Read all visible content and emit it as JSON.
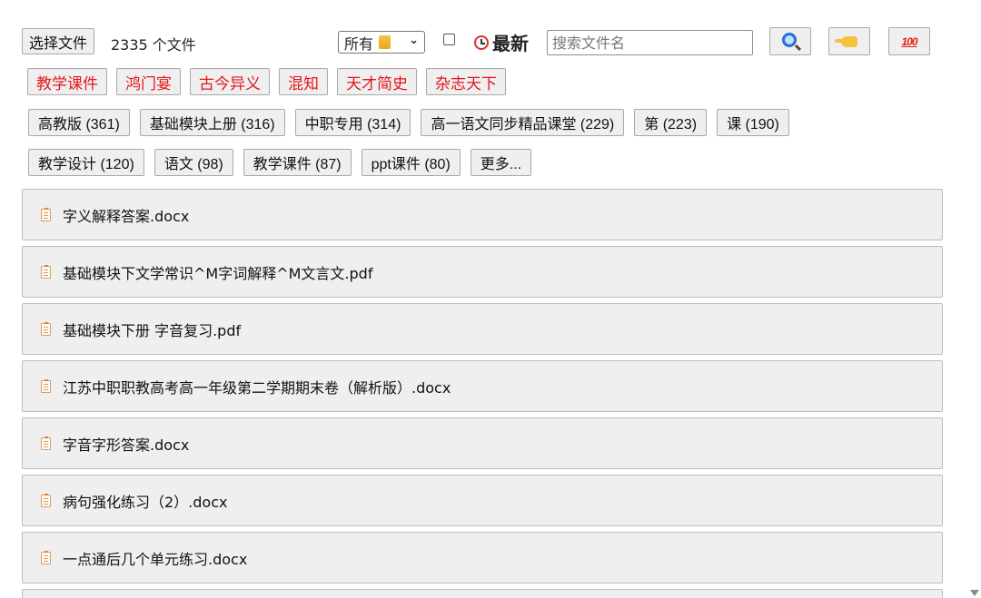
{
  "toolbar": {
    "choose_file_label": "选择文件",
    "file_count": "2335 个文件",
    "filter_select": {
      "selected": "所有"
    },
    "latest_label": "最新",
    "search": {
      "value": "",
      "placeholder": "搜索文件名"
    },
    "search_button_icon": "magnifier-icon",
    "pointing_button_icon": "pointing-hand-icon",
    "hundred_button_icon": "hundred-points-icon",
    "hundred_text": "100"
  },
  "categories": [
    {
      "label": "教学课件"
    },
    {
      "label": "鸿门宴"
    },
    {
      "label": "古今异义"
    },
    {
      "label": "混知"
    },
    {
      "label": "天才简史"
    },
    {
      "label": "杂志天下"
    }
  ],
  "tags_row1": [
    {
      "label": "高教版 (361)"
    },
    {
      "label": "基础模块上册 (316)"
    },
    {
      "label": "中职专用 (314)"
    },
    {
      "label": "高一语文同步精品课堂 (229)"
    },
    {
      "label": "第 (223)"
    },
    {
      "label": "课 (190)"
    }
  ],
  "tags_row2": [
    {
      "label": "教学设计 (120)"
    },
    {
      "label": "语文 (98)"
    },
    {
      "label": "教学课件 (87)"
    },
    {
      "label": "ppt课件 (80)"
    },
    {
      "label": "更多..."
    }
  ],
  "files": [
    {
      "name": "字义解释答案.docx"
    },
    {
      "name": "基础模块下文学常识^M字词解释^M文言文.pdf"
    },
    {
      "name": "基础模块下册 字音复习.pdf"
    },
    {
      "name": "江苏中职职教高考高一年级第二学期期末卷（解析版）.docx"
    },
    {
      "name": "字音字形答案.docx"
    },
    {
      "name": "病句强化练习（2）.docx"
    },
    {
      "name": "一点通后几个单元练习.docx"
    }
  ],
  "colors": {
    "category_text": "#e4161b",
    "button_bg": "#efefef",
    "button_border": "#a9a9a9",
    "file_icon": "#d9a06b"
  }
}
